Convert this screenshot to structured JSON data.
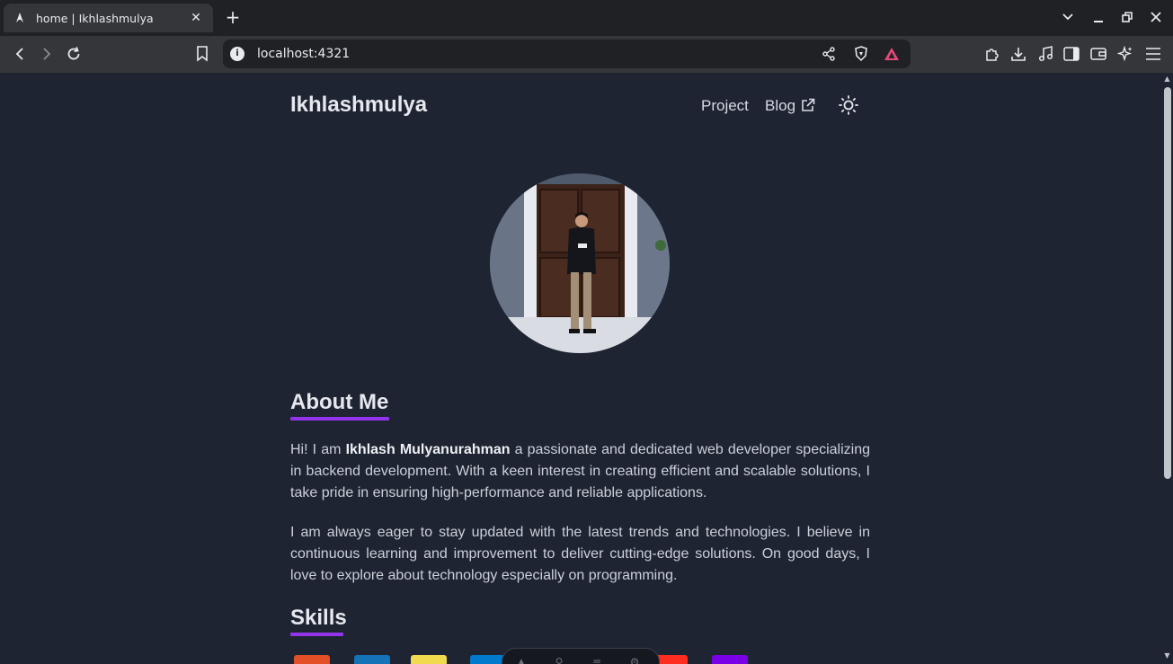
{
  "browser": {
    "tab_title": "home | Ikhlashmulya",
    "new_tab_label": "+",
    "url": "localhost:4321"
  },
  "site": {
    "name": "Ikhlashmulya",
    "nav": {
      "project": "Project",
      "blog": "Blog"
    }
  },
  "about": {
    "title": "About Me",
    "para1_before": "Hi! I am ",
    "para1_name": "Ikhlash Mulyanurahman",
    "para1_after": " a passionate and dedicated web developer specializing in backend development. With a keen interest in creating efficient and scalable solutions, I take pride in ensuring high-performance and reliable applications.",
    "para2": "I am always eager to stay updated with the latest trends and technologies. I believe in continuous learning and improvement to deliver cutting-edge solutions. On good days, I love to explore about technology especially on programming."
  },
  "skills": {
    "title": "Skills",
    "items": [
      {
        "name": "html-icon",
        "color": "#e34f26"
      },
      {
        "name": "css-icon",
        "color": "#1572b6"
      },
      {
        "name": "javascript-icon",
        "color": "#f0db4f"
      },
      {
        "name": "typescript-icon",
        "color": "#007acc"
      },
      {
        "name": "laravel-icon",
        "color": "#ff2d20"
      },
      {
        "name": "php-icon",
        "color": "#7a00e6"
      }
    ]
  },
  "colors": {
    "background": "#1e2432",
    "accent": "#9333ea",
    "text": "#cbd0d9"
  }
}
